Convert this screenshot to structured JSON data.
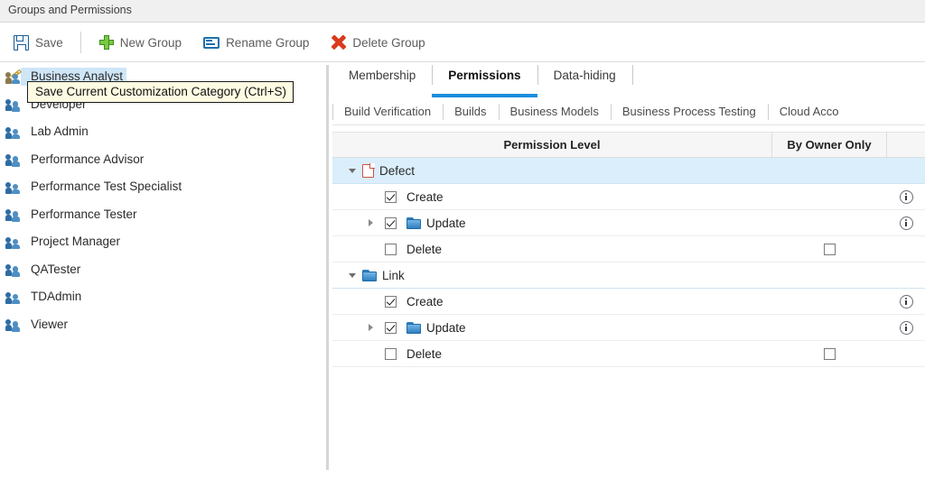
{
  "window": {
    "title": "Groups and Permissions"
  },
  "toolbar": {
    "save_label": "Save",
    "new_group_label": "New Group",
    "rename_group_label": "Rename Group",
    "delete_group_label": "Delete Group"
  },
  "tooltip": {
    "text": "Save Current Customization Category (Ctrl+S)"
  },
  "sidebar": {
    "items": [
      {
        "label": "Business Analyst",
        "selected": true,
        "icon": "group-edit-icon"
      },
      {
        "label": "Developer",
        "selected": false,
        "icon": "group-icon"
      },
      {
        "label": "Lab Admin",
        "selected": false,
        "icon": "group-icon"
      },
      {
        "label": "Performance Advisor",
        "selected": false,
        "icon": "group-icon"
      },
      {
        "label": "Performance Test Specialist",
        "selected": false,
        "icon": "group-icon"
      },
      {
        "label": "Performance Tester",
        "selected": false,
        "icon": "group-icon"
      },
      {
        "label": "Project Manager",
        "selected": false,
        "icon": "group-icon"
      },
      {
        "label": "QATester",
        "selected": false,
        "icon": "group-icon"
      },
      {
        "label": "TDAdmin",
        "selected": false,
        "icon": "group-icon"
      },
      {
        "label": "Viewer",
        "selected": false,
        "icon": "group-icon"
      }
    ]
  },
  "main": {
    "primary_tabs": [
      {
        "label": "Membership",
        "active": false
      },
      {
        "label": "Permissions",
        "active": true
      },
      {
        "label": "Data-hiding",
        "active": false
      }
    ],
    "sub_tabs": [
      {
        "label": "Build Verification"
      },
      {
        "label": "Builds"
      },
      {
        "label": "Business Models"
      },
      {
        "label": "Business Process Testing"
      },
      {
        "label": "Cloud Acco"
      }
    ],
    "table": {
      "columns": [
        "Permission Level",
        "By Owner Only",
        ""
      ],
      "rows": [
        {
          "type": "group",
          "label": "Defect",
          "icon": "document-icon",
          "expanded": true,
          "checkbox": null,
          "owner_checkbox": null,
          "info": false,
          "highlighted": true
        },
        {
          "type": "item",
          "label": "Create",
          "icon": null,
          "expander": false,
          "checkbox": "checked",
          "owner_checkbox": null,
          "info": true,
          "highlighted": false
        },
        {
          "type": "item",
          "label": "Update",
          "icon": "folder-icon",
          "expander": true,
          "checkbox": "checked",
          "owner_checkbox": null,
          "info": true,
          "highlighted": false
        },
        {
          "type": "item",
          "label": "Delete",
          "icon": null,
          "expander": false,
          "checkbox": "unchecked",
          "owner_checkbox": "unchecked",
          "info": false,
          "highlighted": false
        },
        {
          "type": "group",
          "label": "Link",
          "icon": "folder-icon",
          "expanded": true,
          "checkbox": null,
          "owner_checkbox": null,
          "info": false,
          "highlighted": false
        },
        {
          "type": "item",
          "label": "Create",
          "icon": null,
          "expander": false,
          "checkbox": "checked",
          "owner_checkbox": null,
          "info": true,
          "highlighted": false
        },
        {
          "type": "item",
          "label": "Update",
          "icon": "folder-icon",
          "expander": true,
          "checkbox": "checked",
          "owner_checkbox": null,
          "info": true,
          "highlighted": false
        },
        {
          "type": "item",
          "label": "Delete",
          "icon": null,
          "expander": false,
          "checkbox": "unchecked",
          "owner_checkbox": "unchecked",
          "info": false,
          "highlighted": false
        }
      ]
    }
  },
  "colors": {
    "accent": "#1a8fdd",
    "selection": "#cfe6f7",
    "group_row": "#daeefb",
    "tooltip_bg": "#fdfbe2",
    "titlebar_bg": "#f0f0f0"
  }
}
